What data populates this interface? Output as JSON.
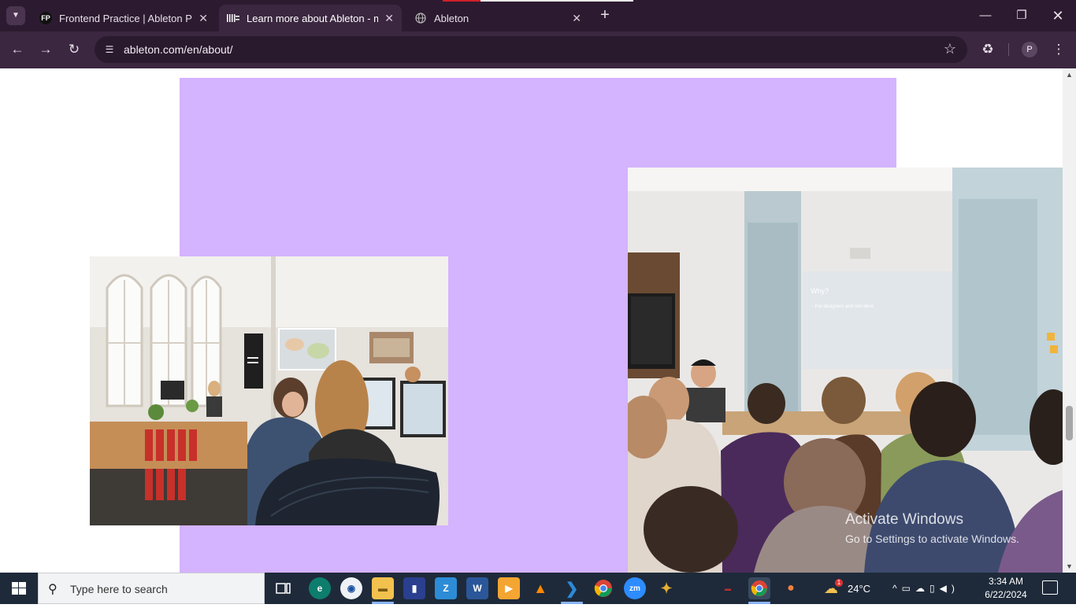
{
  "browser": {
    "tabs": [
      {
        "favicon_text": "FP",
        "title": "Frontend Practice | Ableton Pro",
        "active": false
      },
      {
        "favicon_text": "",
        "title": "Learn more about Ableton - ma",
        "active": true
      },
      {
        "favicon_text": "",
        "title": "Ableton",
        "active": false
      }
    ],
    "address": "ableton.com/en/about/",
    "profile_initial": "P"
  },
  "page": {
    "accent_color": "#d4b3ff"
  },
  "watermark": {
    "line1": "Activate Windows",
    "line2": "Go to Settings to activate Windows."
  },
  "taskbar": {
    "search_placeholder": "Type here to search",
    "weather": "24°C",
    "weather_badge": "1",
    "time": "3:34 AM",
    "date": "6/22/2024"
  }
}
